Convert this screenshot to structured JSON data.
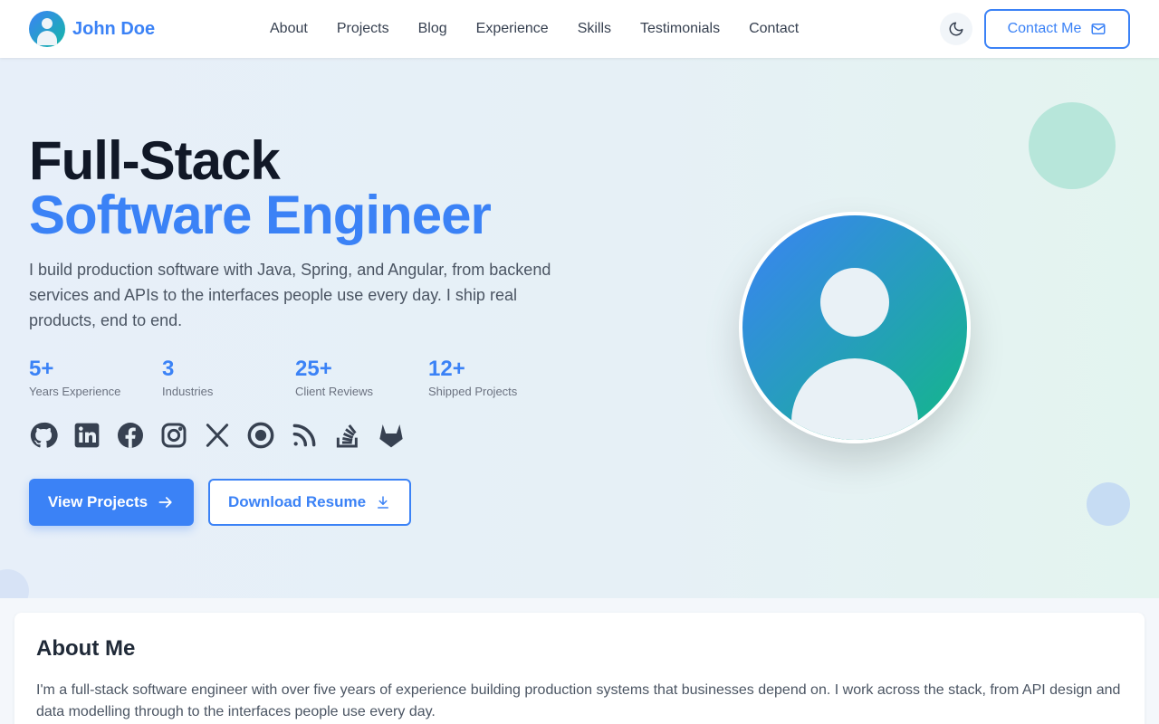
{
  "brand": {
    "name": "John Doe"
  },
  "nav": {
    "links": [
      "About",
      "Projects",
      "Blog",
      "Experience",
      "Skills",
      "Testimonials",
      "Contact"
    ],
    "theme_toggle_icon": "moon-icon",
    "contact_label": "Contact Me",
    "contact_icon": "mail-icon"
  },
  "hero": {
    "title_line1": "Full-Stack",
    "title_line2": "Software Engineer",
    "description": "I build production software with Java, Spring, and Angular, from backend services and APIs to the interfaces people use every day. I ship real products, end to end.",
    "stats": [
      {
        "value": "5+",
        "label": "Years Experience"
      },
      {
        "value": "3",
        "label": "Industries"
      },
      {
        "value": "25+",
        "label": "Client Reviews"
      },
      {
        "value": "12+",
        "label": "Shipped Projects"
      }
    ],
    "socials": [
      "github-icon",
      "linkedin-icon",
      "facebook-icon",
      "instagram-icon",
      "x-icon",
      "record-icon",
      "rss-icon",
      "stackoverflow-icon",
      "gitlab-icon"
    ],
    "primary_button": "View Projects",
    "secondary_button": "Download Resume"
  },
  "about": {
    "title": "About Me",
    "text": "I'm a full-stack software engineer with over five years of experience building production systems that businesses depend on. I work across the stack, from API design and data modelling through to the interfaces people use every day."
  },
  "colors": {
    "accent": "#3b82f6",
    "teal": "#14b8a6",
    "heading": "#111827",
    "body": "#4b5563"
  }
}
